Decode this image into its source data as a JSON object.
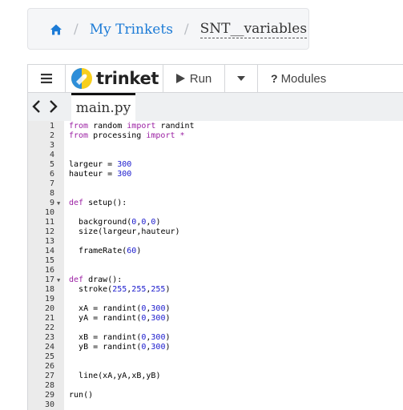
{
  "breadcrumb": {
    "home_icon": "home-icon",
    "separator": "/",
    "link": "My Trinkets",
    "current": "SNT__variables"
  },
  "toolbar": {
    "menu_icon": "hamburger-icon",
    "brand": "trinket",
    "run_label": "Run",
    "modules_label": "Modules"
  },
  "tabs": {
    "active": "main.py"
  },
  "colors": {
    "link": "#1c7bd6",
    "keyword": "#9b1fa3",
    "number": "#1a1acd",
    "gutter": "#ebebeb"
  },
  "editor": {
    "lines": [
      {
        "n": "1",
        "code": "from random import randint"
      },
      {
        "n": "2",
        "code": "from processing import *"
      },
      {
        "n": "3",
        "code": ""
      },
      {
        "n": "4",
        "code": ""
      },
      {
        "n": "5",
        "code": "largeur = 300"
      },
      {
        "n": "6",
        "code": "hauteur = 300"
      },
      {
        "n": "7",
        "code": ""
      },
      {
        "n": "8",
        "code": ""
      },
      {
        "n": "9",
        "code": "def setup():",
        "fold": true
      },
      {
        "n": "10",
        "code": ""
      },
      {
        "n": "11",
        "code": "  background(0,0,0)"
      },
      {
        "n": "12",
        "code": "  size(largeur,hauteur)"
      },
      {
        "n": "13",
        "code": ""
      },
      {
        "n": "14",
        "code": "  frameRate(60)"
      },
      {
        "n": "15",
        "code": ""
      },
      {
        "n": "16",
        "code": ""
      },
      {
        "n": "17",
        "code": "def draw():",
        "fold": true
      },
      {
        "n": "18",
        "code": "  stroke(255,255,255)"
      },
      {
        "n": "19",
        "code": ""
      },
      {
        "n": "20",
        "code": "  xA = randint(0,300)"
      },
      {
        "n": "21",
        "code": "  yA = randint(0,300)"
      },
      {
        "n": "22",
        "code": ""
      },
      {
        "n": "23",
        "code": "  xB = randint(0,300)"
      },
      {
        "n": "24",
        "code": "  yB = randint(0,300)"
      },
      {
        "n": "25",
        "code": ""
      },
      {
        "n": "26",
        "code": ""
      },
      {
        "n": "27",
        "code": "  line(xA,yA,xB,yB)"
      },
      {
        "n": "28",
        "code": ""
      },
      {
        "n": "29",
        "code": "run()"
      },
      {
        "n": "30",
        "code": ""
      }
    ]
  }
}
